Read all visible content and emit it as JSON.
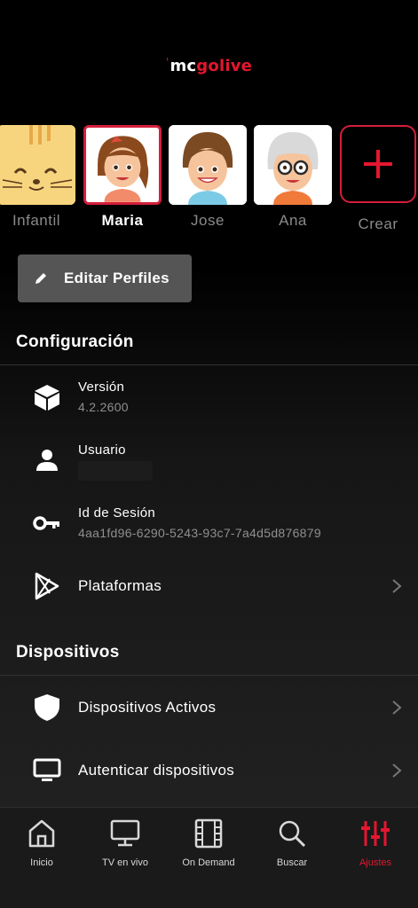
{
  "logo": {
    "tick": "'",
    "part1": "mc",
    "part2": "golive"
  },
  "profiles": [
    {
      "name": "Infantil",
      "avatar": "cat-avatar",
      "active": false
    },
    {
      "name": "Maria",
      "avatar": "girl-avatar",
      "active": true
    },
    {
      "name": "Jose",
      "avatar": "boy-avatar",
      "active": false
    },
    {
      "name": "Ana",
      "avatar": "grandma-avatar",
      "active": false
    }
  ],
  "create_label": "Crear",
  "edit_button": {
    "label": "Editar Perfiles",
    "icon": "pencil-icon"
  },
  "config": {
    "title": "Configuración",
    "version": {
      "label": "Versión",
      "value": "4.2.2600",
      "icon": "cube-icon"
    },
    "user": {
      "label": "Usuario",
      "icon": "person-icon"
    },
    "session": {
      "label": "Id de Sesión",
      "value": "4aa1fd96-6290-5243-93c7-7a4d5d876879",
      "icon": "key-icon"
    },
    "platforms": {
      "label": "Plataformas",
      "icon": "play-store-icon"
    }
  },
  "devices": {
    "title": "Dispositivos",
    "active": {
      "label": "Dispositivos Activos",
      "icon": "shield-icon"
    },
    "auth": {
      "label": "Autenticar dispositivos",
      "icon": "monitor-icon"
    }
  },
  "nav": [
    {
      "label": "Inicio",
      "icon": "home-icon"
    },
    {
      "label": "TV en vivo",
      "icon": "tv-icon"
    },
    {
      "label": "On Demand",
      "icon": "film-icon"
    },
    {
      "label": "Buscar",
      "icon": "search-icon"
    },
    {
      "label": "Ajustes",
      "icon": "sliders-icon",
      "active": true
    }
  ],
  "colors": {
    "accent": "#e5162f",
    "background": "#000000",
    "divider": "#333333",
    "muted_text": "#8f8f8f"
  }
}
